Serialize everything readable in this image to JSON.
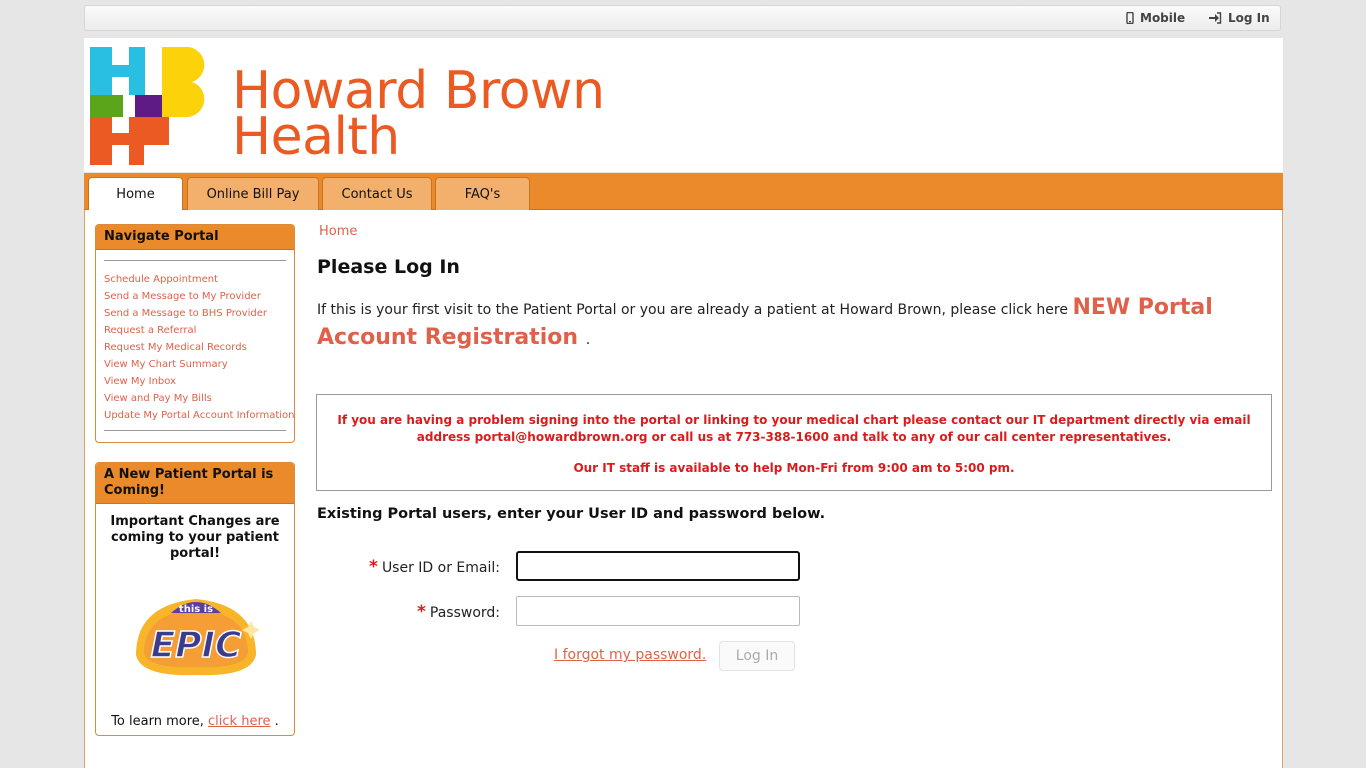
{
  "topbar": {
    "mobile_label": "Mobile",
    "login_label": "Log In"
  },
  "brand": {
    "line1": "Howard Brown",
    "line2": "Health",
    "colors": {
      "cyan": "#29bfe3",
      "yellow": "#fcd20b",
      "green": "#5ba51b",
      "purple": "#5e1b84",
      "orange": "#ea5a22"
    }
  },
  "tabs": [
    {
      "label": "Home",
      "active": true
    },
    {
      "label": "Online Bill Pay",
      "active": false
    },
    {
      "label": "Contact Us",
      "active": false
    },
    {
      "label": "FAQ's",
      "active": false
    }
  ],
  "sidebar": {
    "nav_title": "Navigate Portal",
    "nav_items": [
      {
        "link": "Schedule ",
        "rest": "Appointment"
      },
      {
        "link": "Send ",
        "rest": "a Message to My Provider"
      },
      {
        "link": "Send ",
        "rest": "a Message to BHS Provider"
      },
      {
        "link": "Request ",
        "rest": "a Referral"
      },
      {
        "link": "Request ",
        "rest": "My Medical Records"
      },
      {
        "link": "View ",
        "rest": "My Chart Summary"
      },
      {
        "link": "View ",
        "rest": "My Inbox"
      },
      {
        "link": "View and Pay ",
        "rest": "My Bills"
      },
      {
        "link": "Update ",
        "rest": "My Portal Account Information"
      }
    ],
    "promo_title": "A New Patient Portal is Coming!",
    "promo_body": "Important Changes are coming to your patient portal!",
    "epic_small": "this is",
    "epic_big": "EPIC",
    "promo_foot_prefix": "To learn more, ",
    "promo_foot_link": "click here",
    "promo_foot_suffix": " ."
  },
  "main": {
    "breadcrumb": "Home",
    "title": "Please Log In",
    "intro_text": "If this is your first visit to the Patient Portal or you are already a patient at Howard Brown, please click here ",
    "registration_link": "NEW Portal Account Registration ",
    "intro_suffix": ".",
    "alert_line1": "If you are having a problem signing into the portal or linking to your medical chart please contact our IT department directly via email address portal@howardbrown.org or call us at 773-388-1600 and talk to any of our call center representatives.",
    "alert_line2": "Our IT staff is available to help Mon-Fri from 9:00 am to 5:00 pm.",
    "existing_text": "Existing Portal users, enter your User ID and password below.",
    "user_label": "User ID or Email:",
    "user_value": "",
    "password_label": "Password:",
    "password_value": "",
    "required_mark": "*",
    "forgot_link": "I forgot my password.",
    "login_button": "Log In"
  }
}
